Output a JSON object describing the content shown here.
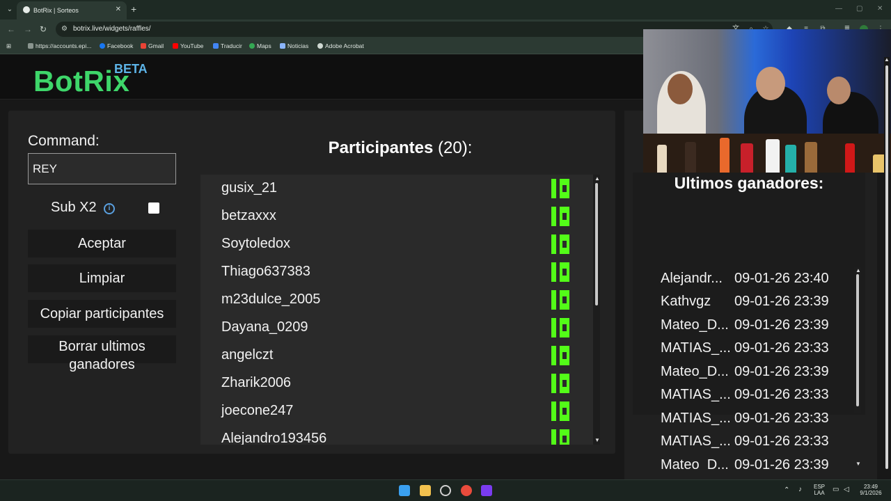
{
  "browser": {
    "tab_title": "BotRix | Sorteos",
    "tab_close": "✕",
    "new_tab": "+",
    "url": "botrix.live/widgets/raffles/",
    "bookmarks": [
      {
        "label": "https://accounts.epi...",
        "color": "#8a958f"
      },
      {
        "label": "Facebook",
        "color": "#1877f2"
      },
      {
        "label": "Gmail",
        "color": "#ea4335"
      },
      {
        "label": "YouTube",
        "color": "#ff0000"
      },
      {
        "label": "Traducir",
        "color": "#4285f4"
      },
      {
        "label": "Maps",
        "color": "#34a853"
      },
      {
        "label": "Noticias",
        "color": "#8ab4f8"
      },
      {
        "label": "Adobe Acrobat",
        "color": "#cfd8d2"
      }
    ]
  },
  "header": {
    "logo": "BotRix",
    "beta": "BETA"
  },
  "form": {
    "command_label": "Command:",
    "command_value": "REY",
    "sub_label": "Sub X2",
    "buttons": {
      "accept": "Aceptar",
      "clear": "Limpiar",
      "copy": "Copiar participantes",
      "delete_line1": "Borrar ultimos",
      "delete_line2": "ganadores"
    }
  },
  "participants": {
    "title": "Participantes",
    "count": "(20):",
    "items": [
      "gusix_21",
      "betzaxxx",
      "Soytoledox",
      "Thiago637383",
      "m23dulce_2005",
      "Dayana_0209",
      "angelczt",
      "Zharik2006",
      "joecone247",
      "Alejandro193456"
    ]
  },
  "winners": {
    "title": "Ultimos ganadores:",
    "items": [
      {
        "name": "Alejandr...",
        "date": "09-01-26 23:40"
      },
      {
        "name": "Kathvgz",
        "date": "09-01-26 23:39"
      },
      {
        "name": "Mateo_D...",
        "date": "09-01-26 23:39"
      },
      {
        "name": "MATIAS_...",
        "date": "09-01-26 23:33"
      },
      {
        "name": "Mateo_D...",
        "date": "09-01-26 23:39"
      },
      {
        "name": "MATIAS_...",
        "date": "09-01-26 23:33"
      },
      {
        "name": "MATIAS_...",
        "date": "09-01-26 23:33"
      },
      {
        "name": "MATIAS_...",
        "date": "09-01-26 23:33"
      },
      {
        "name": "Mateo_D...",
        "date": "09-01-26 23:39"
      }
    ]
  },
  "taskbar": {
    "lang_line1": "ESP",
    "lang_line2": "LAA",
    "time": "23:49",
    "date": "9/1/2026"
  },
  "colors": {
    "brand_green": "#3ed66a",
    "beta_blue": "#5db4e8",
    "kick_green": "#53fc18"
  }
}
